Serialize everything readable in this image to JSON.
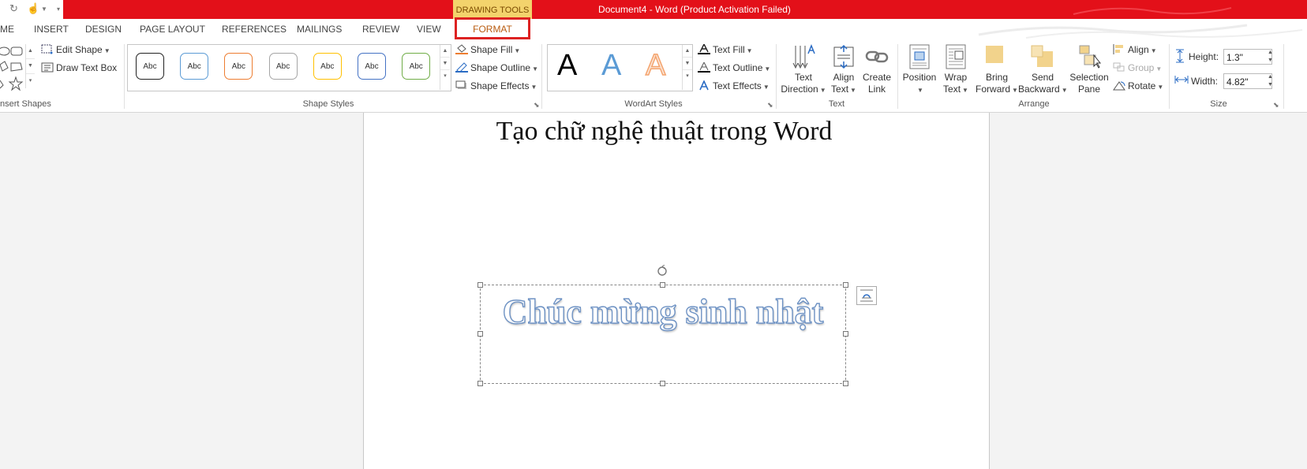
{
  "titlebar": {
    "context_label": "DRAWING TOOLS",
    "doc_title": "Document4 -  Word (Product Activation Failed)"
  },
  "tabs": [
    "ME",
    "INSERT",
    "DESIGN",
    "PAGE LAYOUT",
    "REFERENCES",
    "MAILINGS",
    "REVIEW",
    "VIEW",
    "FORMAT"
  ],
  "ribbon": {
    "insert_shapes": {
      "edit_shape": "Edit Shape",
      "draw_text_box": "Draw Text Box",
      "label": "nsert Shapes"
    },
    "shape_styles": {
      "thumb_label": "Abc",
      "thumb_colors": [
        "#222222",
        "#5b9bd5",
        "#ed7d31",
        "#a5a5a5",
        "#ffc000",
        "#4472c4",
        "#70ad47"
      ],
      "fill": "Shape Fill",
      "outline": "Shape Outline",
      "effects": "Shape Effects",
      "label": "Shape Styles"
    },
    "wordart_styles": {
      "letter": "A",
      "text_fill": "Text Fill",
      "text_outline": "Text Outline",
      "text_effects": "Text Effects",
      "label": "WordArt Styles"
    },
    "text_group": {
      "direction_line1": "Text",
      "direction_line2": "Direction",
      "align_line1": "Align",
      "align_line2": "Text",
      "create_line1": "Create",
      "create_line2": "Link",
      "label": "Text"
    },
    "arrange": {
      "position": "Position",
      "wrap_line1": "Wrap",
      "wrap_line2": "Text",
      "bring_line1": "Bring",
      "bring_line2": "Forward",
      "send_line1": "Send",
      "send_line2": "Backward",
      "selection_line1": "Selection",
      "selection_line2": "Pane",
      "align": "Align",
      "group": "Group",
      "rotate": "Rotate",
      "label": "Arrange"
    },
    "size": {
      "height_label": "Height:",
      "height_value": "1.3\"",
      "width_label": "Width:",
      "width_value": "4.82\"",
      "label": "Size"
    }
  },
  "document": {
    "heading": "Tạo chữ nghệ thuật trong Word",
    "wordart_text": "Chúc mừng sinh nhật"
  }
}
